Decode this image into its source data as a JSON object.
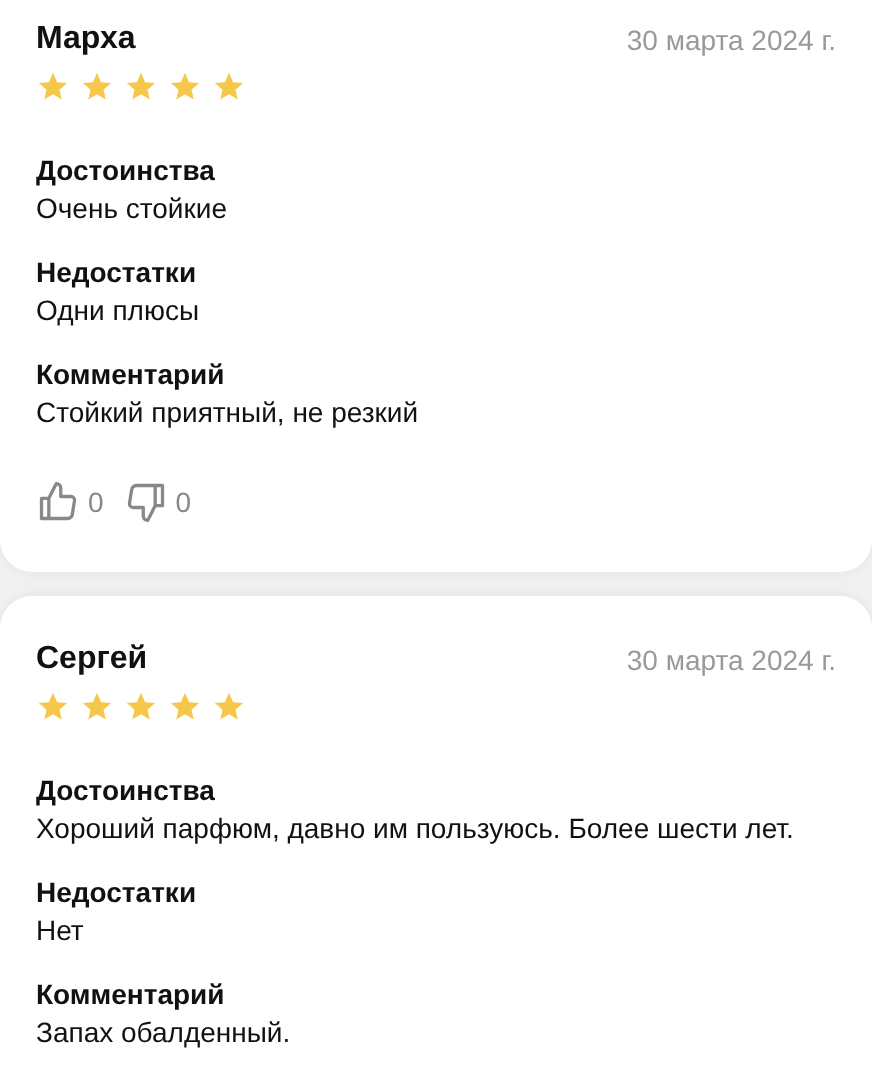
{
  "reviews": [
    {
      "author": "Марха",
      "date": "30 марта 2024 г.",
      "stars": 5,
      "sections": [
        {
          "heading": "Достоинства",
          "text": "Очень стойкие"
        },
        {
          "heading": "Недостатки",
          "text": "Одни плюсы"
        },
        {
          "heading": "Комментарий",
          "text": "Стойкий приятный, не резкий"
        }
      ],
      "likes": "0",
      "dislikes": "0"
    },
    {
      "author": "Сергей",
      "date": "30 марта 2024 г.",
      "stars": 5,
      "sections": [
        {
          "heading": "Достоинства",
          "text": "Хороший парфюм, давно им пользуюсь. Более шести лет."
        },
        {
          "heading": "Недостатки",
          "text": "Нет"
        },
        {
          "heading": "Комментарий",
          "text": "Запах обалденный."
        }
      ]
    }
  ]
}
